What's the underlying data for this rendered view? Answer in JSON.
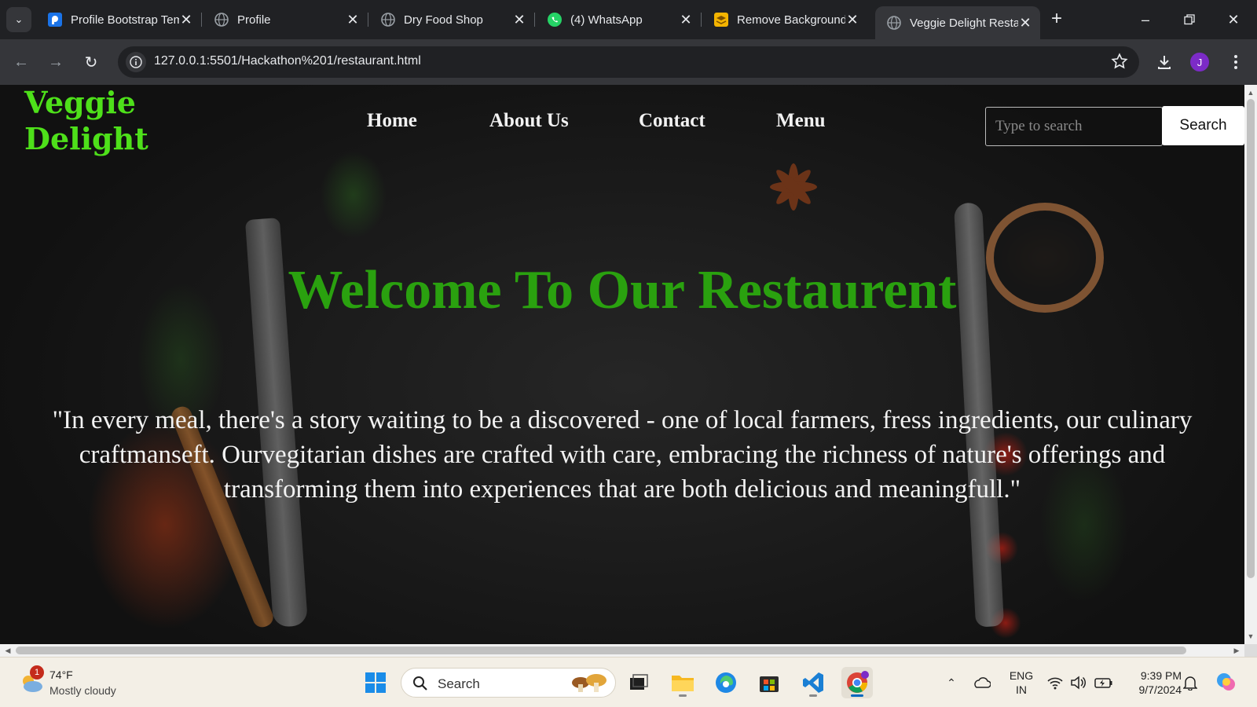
{
  "browser": {
    "tabs": [
      {
        "title": "Profile Bootstrap Templa",
        "icon": "bootstrap-icon"
      },
      {
        "title": "Profile",
        "icon": "globe-icon"
      },
      {
        "title": "Dry Food Shop",
        "icon": "globe-icon"
      },
      {
        "title": "(4) WhatsApp",
        "icon": "whatsapp-icon"
      },
      {
        "title": "Remove Background",
        "icon": "removebg-icon"
      },
      {
        "title": "Veggie Delight Restaurant",
        "icon": "globe-icon",
        "active": true
      }
    ],
    "url": "127.0.0.1:5501/Hackathon%201/restaurant.html",
    "profile_initial": "J"
  },
  "page": {
    "brand_line1": "Veggie",
    "brand_line2": "Delight",
    "nav": [
      "Home",
      "About Us",
      "Contact",
      "Menu"
    ],
    "search_placeholder": "Type to search",
    "search_button": "Search",
    "hero_title": "Welcome To Our Restaurent",
    "hero_quote": "\"In every meal, there's a story waiting to be a discovered - one of local farmers, fress ingredients, our culinary craftmanseft. Ourvegitarian dishes are crafted with care, embracing the richness of nature's offerings and transforming them into experiences that are both delicious and meaningfull.\"",
    "colors": {
      "brand": "#4ee01a",
      "hero_title": "#2aa10f"
    }
  },
  "taskbar": {
    "weather_badge": "1",
    "weather_temp": "74°F",
    "weather_condition": "Mostly cloudy",
    "search_label": "Search",
    "lang_line1": "ENG",
    "lang_line2": "IN",
    "time": "9:39 PM",
    "date": "9/7/2024"
  }
}
